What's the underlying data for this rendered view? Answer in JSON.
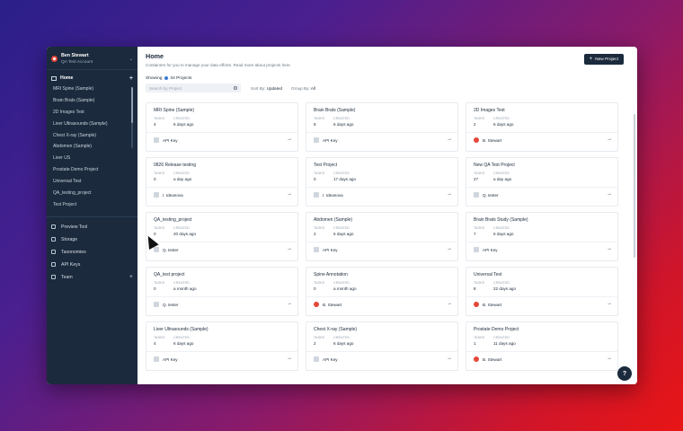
{
  "account": {
    "name": "Ben Stewart",
    "subtitle": "QA Test Account"
  },
  "nav": {
    "home_label": "Home",
    "projects": [
      "MRI Spine (Sample)",
      "Brain Brats (Sample)",
      "2D Images Test",
      "Liver Ultrasounds (Sample)",
      "Chest X-ray (Sample)",
      "Abdomen (Sample)",
      "Liver US",
      "Prostate Demo Project",
      "Universal Test",
      "QA_testing_project",
      "Test Project"
    ],
    "tools": [
      {
        "label": "Preview Tool",
        "icon": "preview-icon",
        "plus": ""
      },
      {
        "label": "Storage",
        "icon": "storage-icon",
        "plus": ""
      },
      {
        "label": "Taxonomies",
        "icon": "taxonomy-icon",
        "plus": ""
      },
      {
        "label": "API Keys",
        "icon": "key-icon",
        "plus": ""
      },
      {
        "label": "Team",
        "icon": "team-icon",
        "plus": "+"
      }
    ]
  },
  "header": {
    "title": "Home",
    "subtitle": "Containers for you to manage your data efforts. Read more about projects",
    "subtitle_link": "here",
    "new_project_label": "New Project"
  },
  "toolbar": {
    "showing_label": "Showing",
    "showing_count": "34 Projects",
    "search_placeholder": "Search by Project",
    "sort_prefix": "Sort By:",
    "sort_value": "Updated",
    "group_prefix": "Group By:",
    "group_value": "All"
  },
  "card_labels": {
    "tasks": "TASKS",
    "created": "CREATED"
  },
  "projects": [
    {
      "title": "MRI Spine (Sample)",
      "tasks": "4",
      "created": "6 days ago",
      "owner": "API Key",
      "owner_type": "api"
    },
    {
      "title": "Brain Brats (Sample)",
      "tasks": "8",
      "created": "6 days ago",
      "owner": "API Key",
      "owner_type": "api"
    },
    {
      "title": "2D Images Test",
      "tasks": "2",
      "created": "6 days ago",
      "owner": "B. Stewart",
      "owner_type": "user"
    },
    {
      "title": "0826 Release testing",
      "tasks": "0",
      "created": "a day ago",
      "owner": "I. Ideanova",
      "owner_type": "api"
    },
    {
      "title": "Test Project",
      "tasks": "0",
      "created": "17 days ago",
      "owner": "I. Ideanova",
      "owner_type": "api"
    },
    {
      "title": "New QA Test Project",
      "tasks": "27",
      "created": "a day ago",
      "owner": "Q. tester",
      "owner_type": "api"
    },
    {
      "title": "QA_testing_project",
      "tasks": "0",
      "created": "20 days ago",
      "owner": "Q. tester",
      "owner_type": "api"
    },
    {
      "title": "Abdomen (Sample)",
      "tasks": "2",
      "created": "6 days ago",
      "owner": "API Key",
      "owner_type": "api"
    },
    {
      "title": "Brain Brats Study (Sample)",
      "tasks": "7",
      "created": "6 days ago",
      "owner": "API Key",
      "owner_type": "api"
    },
    {
      "title": "QA_test project",
      "tasks": "0",
      "created": "a month ago",
      "owner": "Q. tester",
      "owner_type": "api"
    },
    {
      "title": "Spine Annotation",
      "tasks": "0",
      "created": "a month ago",
      "owner": "B. Stewart",
      "owner_type": "user"
    },
    {
      "title": "Universal Test",
      "tasks": "8",
      "created": "22 days ago",
      "owner": "B. Stewart",
      "owner_type": "user"
    },
    {
      "title": "Liver Ultrasounds (Sample)",
      "tasks": "4",
      "created": "6 days ago",
      "owner": "API Key",
      "owner_type": "api"
    },
    {
      "title": "Chest X-ray (Sample)",
      "tasks": "2",
      "created": "6 days ago",
      "owner": "API Key",
      "owner_type": "api"
    },
    {
      "title": "Prostate Demo Project",
      "tasks": "1",
      "created": "11 days ago",
      "owner": "B. Stewart",
      "owner_type": "user"
    }
  ],
  "help_label": "?"
}
